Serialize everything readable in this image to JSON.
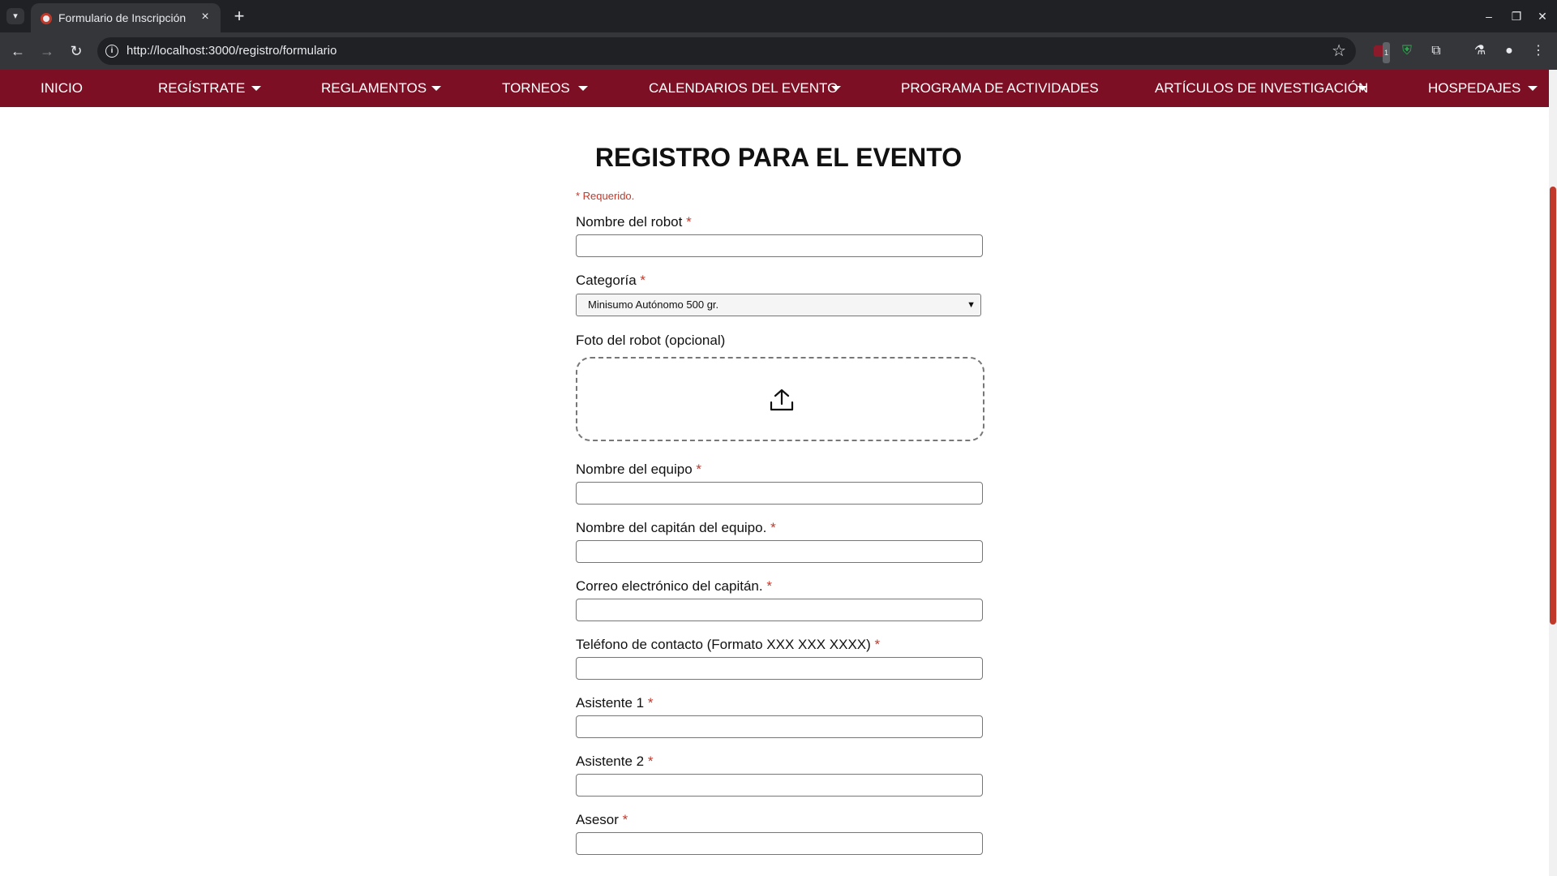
{
  "browser": {
    "tab_title": "Formulario de Inscripción",
    "url": "http://localhost:3000/registro/formulario",
    "extension_badge": "1"
  },
  "nav": {
    "items": [
      {
        "label": "INICIO",
        "has_dropdown": false
      },
      {
        "label": "REGÍSTRATE",
        "has_dropdown": true
      },
      {
        "label": "REGLAMENTOS",
        "has_dropdown": true
      },
      {
        "label": "TORNEOS",
        "has_dropdown": true
      },
      {
        "label": "CALENDARIOS DEL EVENTO",
        "has_dropdown": true
      },
      {
        "label": "PROGRAMA DE ACTIVIDADES",
        "has_dropdown": false
      },
      {
        "label": "ARTÍCULOS DE INVESTIGACIÓN",
        "has_dropdown": true
      },
      {
        "label": "HOSPEDAJES",
        "has_dropdown": true
      }
    ]
  },
  "form": {
    "title": "REGISTRO PARA EL EVENTO",
    "required_note": "* Requerido.",
    "fields": {
      "robot_name": {
        "label": "Nombre del robot",
        "value": ""
      },
      "category": {
        "label": "Categoría",
        "selected": "Minisumo Autónomo 500 gr."
      },
      "photo": {
        "label": "Foto del robot (opcional)"
      },
      "team_name": {
        "label": "Nombre del equipo",
        "value": ""
      },
      "captain_name": {
        "label": "Nombre del capitán del equipo.",
        "value": ""
      },
      "captain_email": {
        "label": "Correo electrónico del capitán.",
        "value": ""
      },
      "phone": {
        "label": "Teléfono de contacto (Formato XXX XXX XXXX)",
        "value": ""
      },
      "assistant1": {
        "label": "Asistente 1",
        "value": ""
      },
      "assistant2": {
        "label": "Asistente 2",
        "value": ""
      },
      "advisor": {
        "label": "Asesor",
        "value": ""
      }
    },
    "required_marker": "*"
  },
  "colors": {
    "nav_bg": "#7d0f24",
    "required": "#c0392b",
    "scroll_thumb": "#c0392b"
  }
}
